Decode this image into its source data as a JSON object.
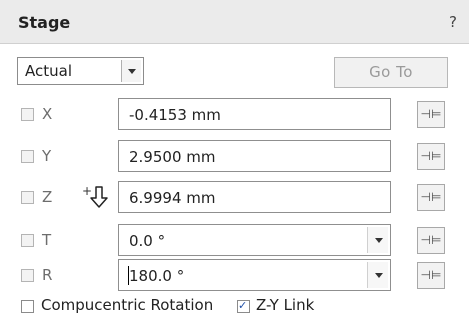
{
  "header": {
    "title": "Stage",
    "help": "?"
  },
  "mode_select": {
    "value": "Actual"
  },
  "goto_button": {
    "label": "Go To"
  },
  "axes": [
    {
      "label": "X",
      "value": "-0.4153 mm",
      "has_dropdown": false
    },
    {
      "label": "Y",
      "value": "2.9500 mm",
      "has_dropdown": false
    },
    {
      "label": "Z",
      "value": "6.9994 mm",
      "has_dropdown": false,
      "indicator": "+⇩"
    },
    {
      "label": "T",
      "value": "0.0 °",
      "has_dropdown": true
    },
    {
      "label": "R",
      "value": "180.0 °",
      "has_dropdown": true
    }
  ],
  "pin_icon": "pin-icon",
  "footer": {
    "compucentric": {
      "label": "Compucentric Rotation",
      "checked": false
    },
    "zy_link": {
      "label": "Z-Y Link",
      "checked": true
    }
  },
  "colors": {
    "header_bg": "#ebebeb",
    "disabled_text": "#9a9a9a",
    "check_blue": "#1f4fa8"
  }
}
